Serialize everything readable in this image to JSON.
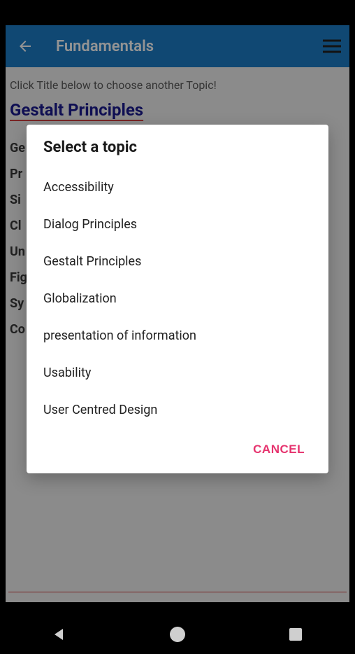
{
  "header": {
    "title": "Fundamentals"
  },
  "content": {
    "hint": "Click Title below to choose another Topic!",
    "topic_title": "Gestalt Principles",
    "bg_items": [
      "Ge",
      "Pr",
      "Si",
      "Cl",
      "Un",
      "Fig",
      "Sy",
      "Co"
    ]
  },
  "dialog": {
    "title": "Select a topic",
    "options": [
      "Accessibility",
      "Dialog Principles",
      "Gestalt Principles",
      "Globalization",
      "presentation of information",
      "Usability",
      "User Centred Design"
    ],
    "cancel_label": "CANCEL"
  }
}
